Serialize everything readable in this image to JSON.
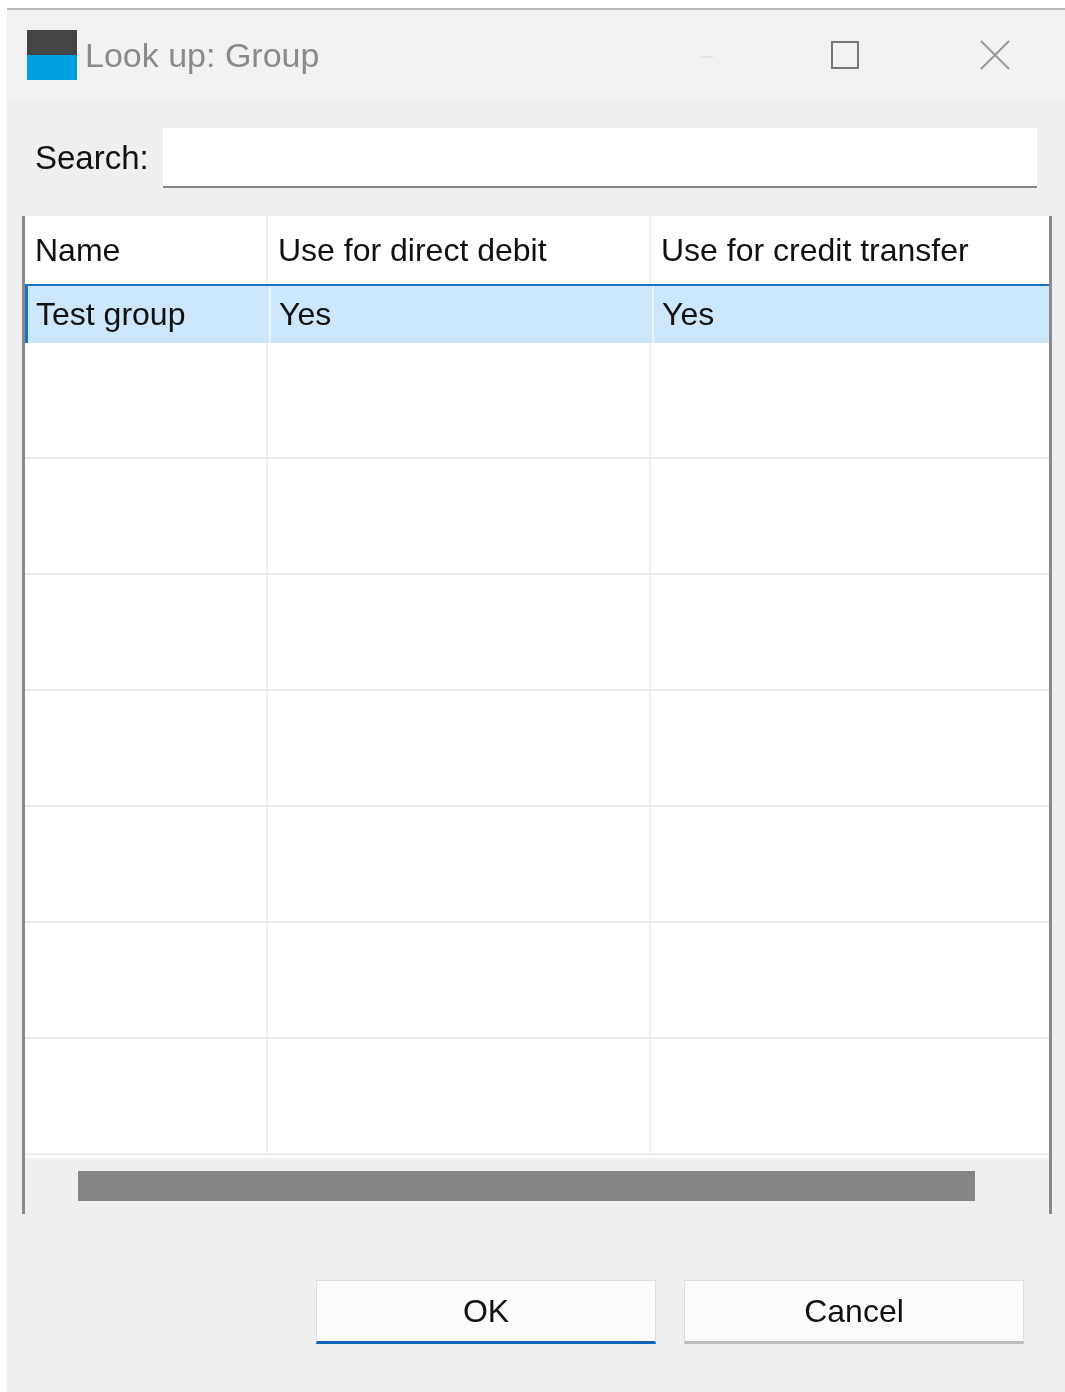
{
  "window": {
    "title": "Look up: Group"
  },
  "search": {
    "label": "Search:"
  },
  "table": {
    "columns": [
      "Name",
      "Use for direct debit",
      "Use for credit transfer"
    ],
    "rows": [
      {
        "cells": [
          "Test group",
          "Yes",
          "Yes"
        ],
        "selected": true
      }
    ]
  },
  "buttons": [
    {
      "label": "OK",
      "default": true
    },
    {
      "label": "Cancel",
      "default": false
    }
  ]
}
